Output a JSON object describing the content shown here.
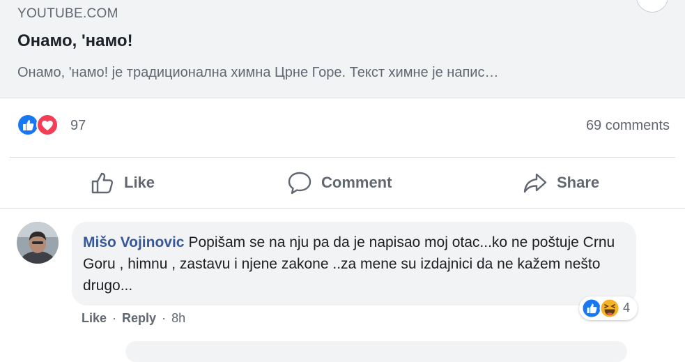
{
  "link_preview": {
    "domain": "YOUTUBE.COM",
    "title": "Онамо, 'намо!",
    "description": "Онамо, 'намо! је традиционална химна Црне Горе. Текст химне је напис…"
  },
  "reactions": {
    "count": "97",
    "icons": [
      "like-reaction-icon",
      "love-reaction-icon"
    ],
    "comments_label": "69 comments"
  },
  "actions": {
    "like_label": "Like",
    "comment_label": "Comment",
    "share_label": "Share"
  },
  "comment": {
    "author": "Mišo Vojinovic",
    "text": "Popišam se na nju pa da je napisao moj otac...ko ne poštuje Crnu Goru , himnu , zastavu i njene zakone ..za mene su izdajnici da ne kažem nešto drugo...",
    "reaction_count": "4",
    "reaction_icons": [
      "like-reaction-icon",
      "haha-reaction-icon"
    ],
    "like_label": "Like",
    "reply_label": "Reply",
    "separator": "·",
    "time": "8h"
  },
  "colors": {
    "link_preview_bg": "#f2f3f5",
    "author_link": "#385898",
    "secondary_text": "#606770",
    "like_blue": "#1877f2",
    "love_red": "#f33e58",
    "haha_yellow": "#f7b125"
  }
}
